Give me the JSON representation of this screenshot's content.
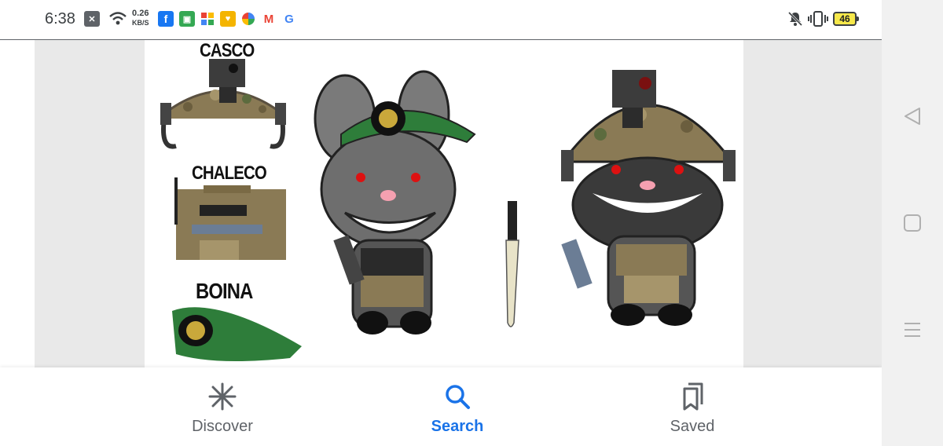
{
  "status_bar": {
    "time": "6:38",
    "network_speed_value": "0.26",
    "network_speed_unit": "KB/S",
    "battery_level": "46"
  },
  "image": {
    "labels": {
      "helmet": "CASCO",
      "vest": "CHALECO",
      "beret": "BOINA"
    },
    "colors": {
      "beret_green": "#2e7d3a",
      "camo_tan": "#8a7a55",
      "bunny_grey": "#6e6e6e"
    }
  },
  "bottom_nav": {
    "items": [
      {
        "label": "Discover",
        "icon": "asterisk-icon"
      },
      {
        "label": "Search",
        "icon": "search-icon",
        "active": true
      },
      {
        "label": "Saved",
        "icon": "bookmarks-icon"
      }
    ],
    "accent": "#1a73e8"
  },
  "system_nav": [
    "back-icon",
    "home-icon",
    "recents-icon"
  ]
}
